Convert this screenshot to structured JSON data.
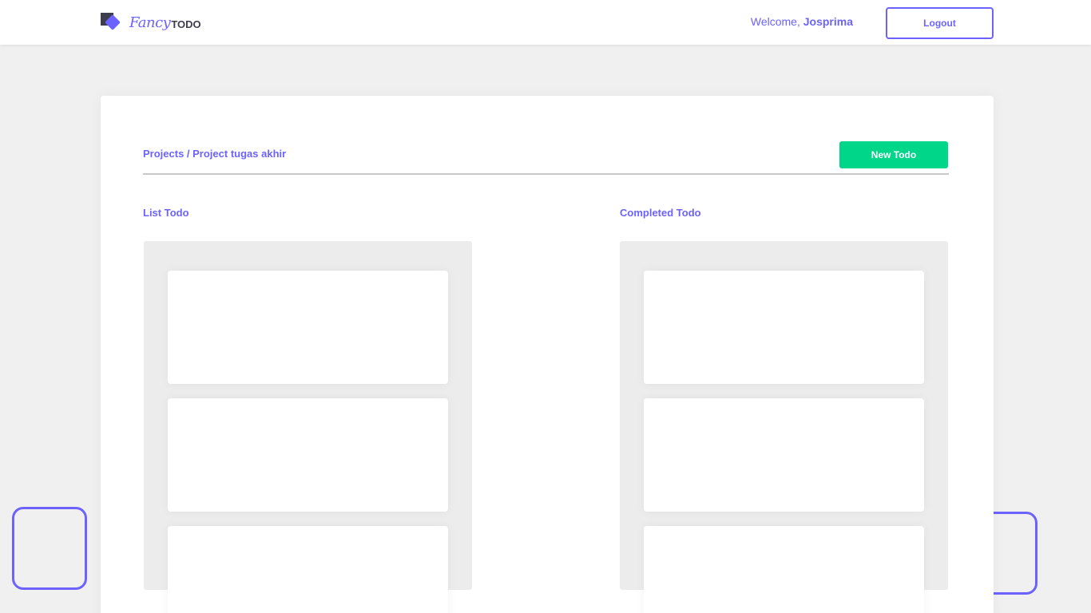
{
  "header": {
    "brand_script": "Fancy",
    "brand_bold": "TODO",
    "welcome_prefix": "Welcome,",
    "username": "Josprima",
    "logout_label": "Logout"
  },
  "project": {
    "breadcrumb": "Projects / Project tugas akhir",
    "new_todo_label": "New Todo"
  },
  "columns": {
    "list_title": "List Todo",
    "completed_title": "Completed Todo"
  },
  "colors": {
    "accent": "#6c63ff",
    "success": "#00d68a",
    "dark": "#3d3d4e",
    "background": "#f0f0f0"
  }
}
